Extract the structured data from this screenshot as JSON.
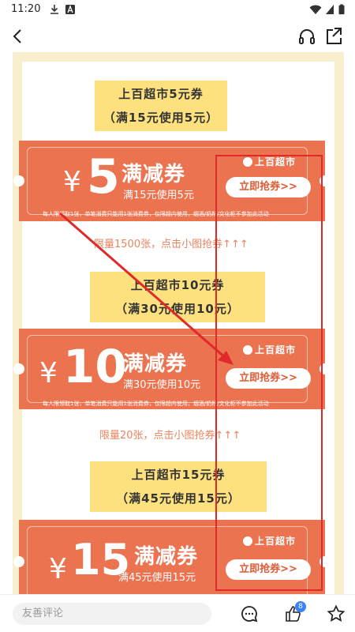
{
  "status_bar": {
    "time": "11:20"
  },
  "comment": {
    "placeholder": "友善评论"
  },
  "like_count": "8",
  "coupons": [
    {
      "title_line1": "上百超市5元券",
      "title_line2": "（满15元使用5元）",
      "yen": "¥",
      "amount": "5",
      "type_label": "满减券",
      "condition": "满15元使用5元",
      "brand": "上百超市",
      "grab_button": "立即抢券>>",
      "fine_print": "每人限领取1张，单笔消费只能用1张消费券，仅限超内使用，烟酒/奶粉/文化柜不参加此活动",
      "limit_text": "限量1500张，点击小图抢券↑↑↑"
    },
    {
      "title_line1": "上百超市10元券",
      "title_line2": "（满30元使用10元）",
      "yen": "¥",
      "amount": "10",
      "type_label": "满减券",
      "condition": "满30元使用10元",
      "brand": "上百超市",
      "grab_button": "立即抢券>>",
      "fine_print": "每人限领取1张，单笔消费只能用1张消费券，仅限超内使用，烟酒/奶粉/文化柜不参加此活动",
      "limit_text": "限量20张，点击小图抢券↑↑↑"
    },
    {
      "title_line1": "上百超市15元券",
      "title_line2": "（满45元使用15元）",
      "yen": "¥",
      "amount": "15",
      "type_label": "满减券",
      "condition": "满45元使用15元",
      "brand": "上百超市",
      "grab_button": "立即抢券>>"
    }
  ],
  "colors": {
    "coupon_bg": "#ec7350",
    "title_bg": "#fde17f",
    "highlight_red": "#e02a2a",
    "page_bg": "#f8efcf"
  }
}
